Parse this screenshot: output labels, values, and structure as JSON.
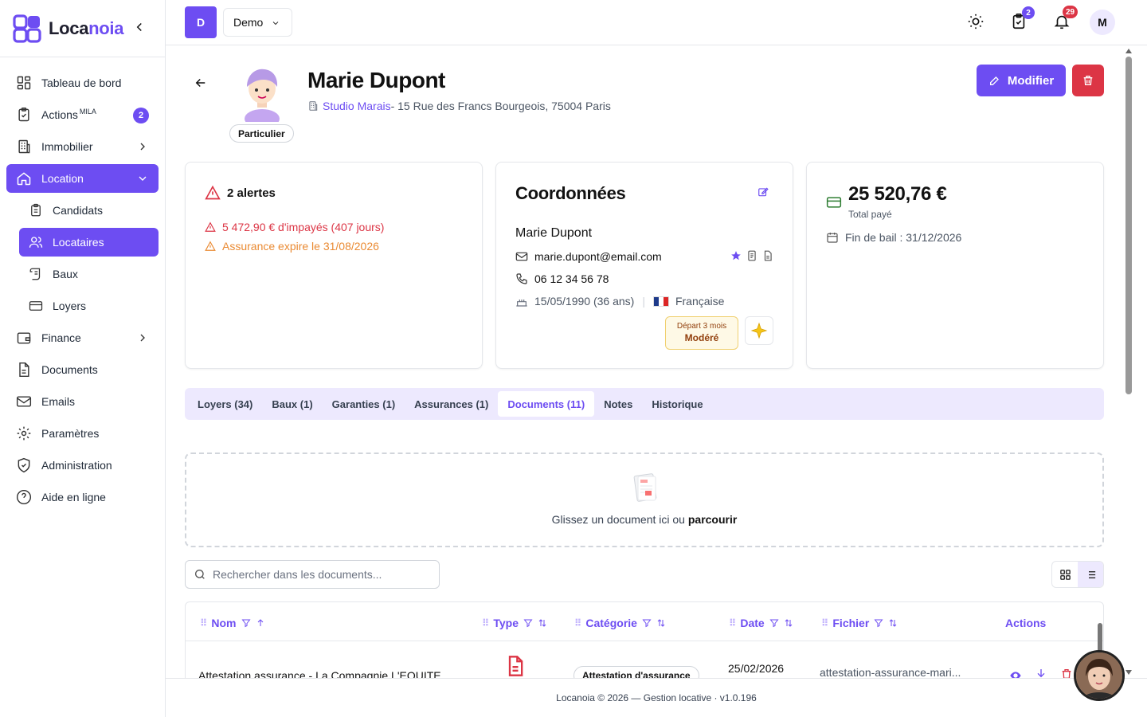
{
  "brand": {
    "name_a": "Loca",
    "name_b": "noia"
  },
  "nav": {
    "dashboard": "Tableau de bord",
    "actions": "Actions",
    "actions_sup": "MILA",
    "actions_badge": "2",
    "immobilier": "Immobilier",
    "location": "Location",
    "candidats": "Candidats",
    "locataires": "Locataires",
    "baux": "Baux",
    "loyers": "Loyers",
    "finance": "Finance",
    "documents": "Documents",
    "emails": "Emails",
    "parametres": "Paramètres",
    "administration": "Administration",
    "aide": "Aide en ligne"
  },
  "topbar": {
    "workspace_initial": "D",
    "workspace_name": "Demo",
    "tasks_badge": "2",
    "notif_badge": "29",
    "user_initial": "M"
  },
  "tenant": {
    "name": "Marie Dupont",
    "type": "Particulier",
    "property": "Studio Marais",
    "address": " - 15 Rue des Francs Bourgeois, 75004 Paris",
    "edit_label": "Modifier"
  },
  "alerts": {
    "title": "2 alertes",
    "items": [
      "5 472,90 € d'impayés (407 jours)",
      "Assurance expire le 31/08/2026"
    ]
  },
  "contact": {
    "title": "Coordonnées",
    "name": "Marie Dupont",
    "email": "marie.dupont@email.com",
    "phone": "06 12 34 56 78",
    "birth": "15/05/1990 (36 ans)",
    "nationality": "Française",
    "depart_small": "Départ 3 mois",
    "depart_level": "Modéré"
  },
  "finance": {
    "total": "25 520,76 €",
    "total_label": "Total payé",
    "lease_end": "Fin de bail : 31/12/2026"
  },
  "tabs": [
    "Loyers (34)",
    "Baux (1)",
    "Garanties (1)",
    "Assurances (1)",
    "Documents (11)",
    "Notes",
    "Historique"
  ],
  "dropzone": {
    "text": "Glissez un document ici ou ",
    "link": "parcourir"
  },
  "search": {
    "placeholder": "Rechercher dans les documents..."
  },
  "table": {
    "headers": {
      "nom": "Nom",
      "type": "Type",
      "categorie": "Catégorie",
      "date": "Date",
      "fichier": "Fichier",
      "actions": "Actions"
    },
    "rows": [
      {
        "nom": "Attestation assurance - La Compagnie L'EQUITE",
        "categorie": "Attestation d'assurance",
        "date": "25/02/2026",
        "fichier": "attestation-assurance-mari..."
      }
    ]
  },
  "footer": "Locanoia © 2026 — Gestion locative · v1.0.196",
  "colors": {
    "accent": "#6d4df2",
    "danger": "#dc3545",
    "warning": "#ea8a32"
  }
}
